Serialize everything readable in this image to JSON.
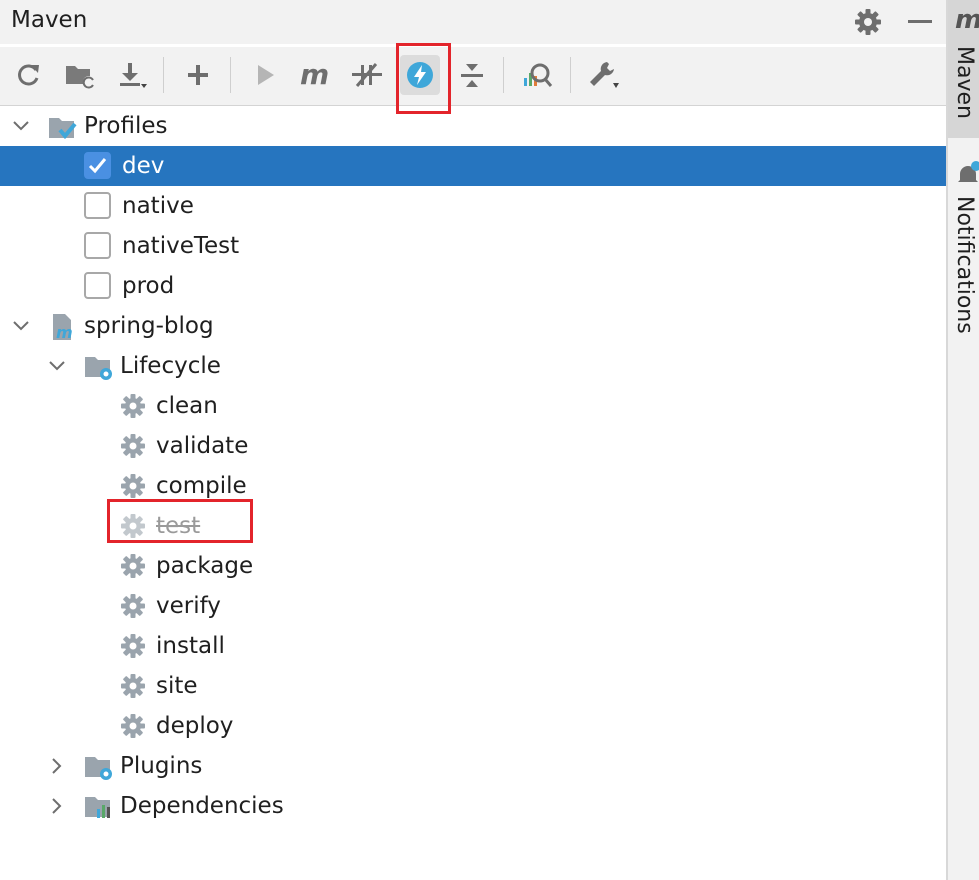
{
  "panel": {
    "title": "Maven"
  },
  "header": {
    "settings_icon": "gear-icon",
    "minimize_icon": "minimize-icon"
  },
  "toolbar": {
    "buttons": [
      {
        "name": "reload-all-projects",
        "icon": "refresh-icon"
      },
      {
        "name": "generate-sources",
        "icon": "folder-refresh-icon"
      },
      {
        "name": "download-sources",
        "icon": "download-icon"
      },
      {
        "name": "add-maven-project",
        "icon": "plus-icon"
      },
      {
        "name": "run-maven-build",
        "icon": "play-icon"
      },
      {
        "name": "execute-maven-goal",
        "icon": "maven-m-icon"
      },
      {
        "name": "toggle-offline-mode",
        "icon": "offline-icon"
      },
      {
        "name": "toggle-skip-tests-mode",
        "icon": "lightning-icon",
        "active": true
      },
      {
        "name": "collapse-all",
        "icon": "collapse-icon"
      },
      {
        "name": "analyze-dependencies",
        "icon": "analyze-icon"
      },
      {
        "name": "maven-settings",
        "icon": "wrench-icon"
      }
    ]
  },
  "tree": {
    "profiles": {
      "label": "Profiles",
      "items": [
        {
          "label": "dev",
          "checked": true
        },
        {
          "label": "native",
          "checked": false
        },
        {
          "label": "nativeTest",
          "checked": false
        },
        {
          "label": "prod",
          "checked": false
        }
      ]
    },
    "project": {
      "label": "spring-blog",
      "lifecycle": {
        "label": "Lifecycle",
        "phases": [
          {
            "label": "clean"
          },
          {
            "label": "validate"
          },
          {
            "label": "compile"
          },
          {
            "label": "test",
            "skipped": true
          },
          {
            "label": "package"
          },
          {
            "label": "verify"
          },
          {
            "label": "install"
          },
          {
            "label": "site"
          },
          {
            "label": "deploy"
          }
        ]
      },
      "plugins": {
        "label": "Plugins"
      },
      "dependencies": {
        "label": "Dependencies"
      }
    }
  },
  "sidebar": {
    "maven_tab": "Maven",
    "maven_tab_glyph": "m",
    "notifications_tab": "Notifications"
  },
  "colors": {
    "selection": "#2675bf",
    "highlight_box": "#e3242b",
    "checkbox_checked": "#4a90e2",
    "skipped_text": "#9a9a9a"
  }
}
